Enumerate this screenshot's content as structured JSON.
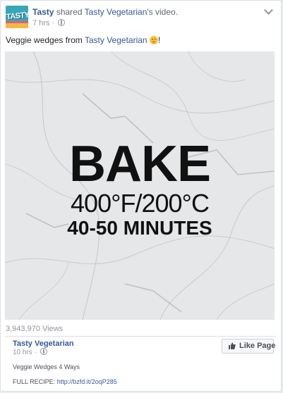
{
  "post": {
    "avatar_text": "TASTY",
    "author": "Tasty",
    "shared_text": "shared",
    "shared_page": "Tasty Vegetarian",
    "shared_suffix": "'s video.",
    "time": "7 hrs",
    "separator": "·",
    "caption_prefix": "Veggie wedges from ",
    "caption_link": "Tasty Vegetarian",
    "caption_suffix": "!",
    "icons": [
      "globe-icon",
      "chevron-down-icon",
      "grinning-emoji-icon"
    ]
  },
  "video": {
    "line1": "BAKE",
    "line2": "400°F/200°C",
    "line3": "40-50 MINUTES"
  },
  "stats": {
    "views": "3,943,970 Views"
  },
  "attribution": {
    "page_name": "Tasty Vegetarian",
    "time": "10 hrs",
    "separator": "·",
    "like_button": "Like Page",
    "description": "Veggie Wedges 4 Ways",
    "recipe_label": "FULL RECIPE: ",
    "recipe_link": "http://bzfd.it/2oqP285"
  },
  "colors": {
    "link": "#365899",
    "muted": "#90949c",
    "marble": "#e4e6e8"
  }
}
